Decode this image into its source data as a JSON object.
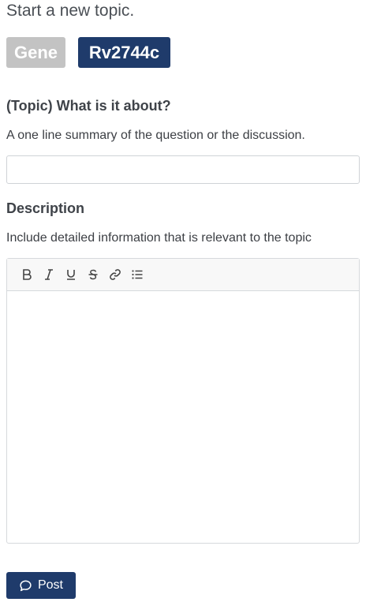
{
  "page": {
    "title": "Start a new topic."
  },
  "badges": {
    "gene": "Gene",
    "id": "Rv2744c"
  },
  "topic": {
    "heading": "(Topic) What is it about?",
    "help": "A one line summary of the question or the discussion.",
    "value": "",
    "placeholder": ""
  },
  "description": {
    "heading": "Description",
    "help": "Include detailed information that is relevant to the topic"
  },
  "toolbar": {
    "icons": [
      "bold-icon",
      "italic-icon",
      "underline-icon",
      "strikethrough-icon",
      "link-icon",
      "bullet-list-icon"
    ]
  },
  "post": {
    "label": "Post"
  },
  "colors": {
    "accent": "#1f3b6b",
    "badge_gray": "#c3c3c3"
  }
}
